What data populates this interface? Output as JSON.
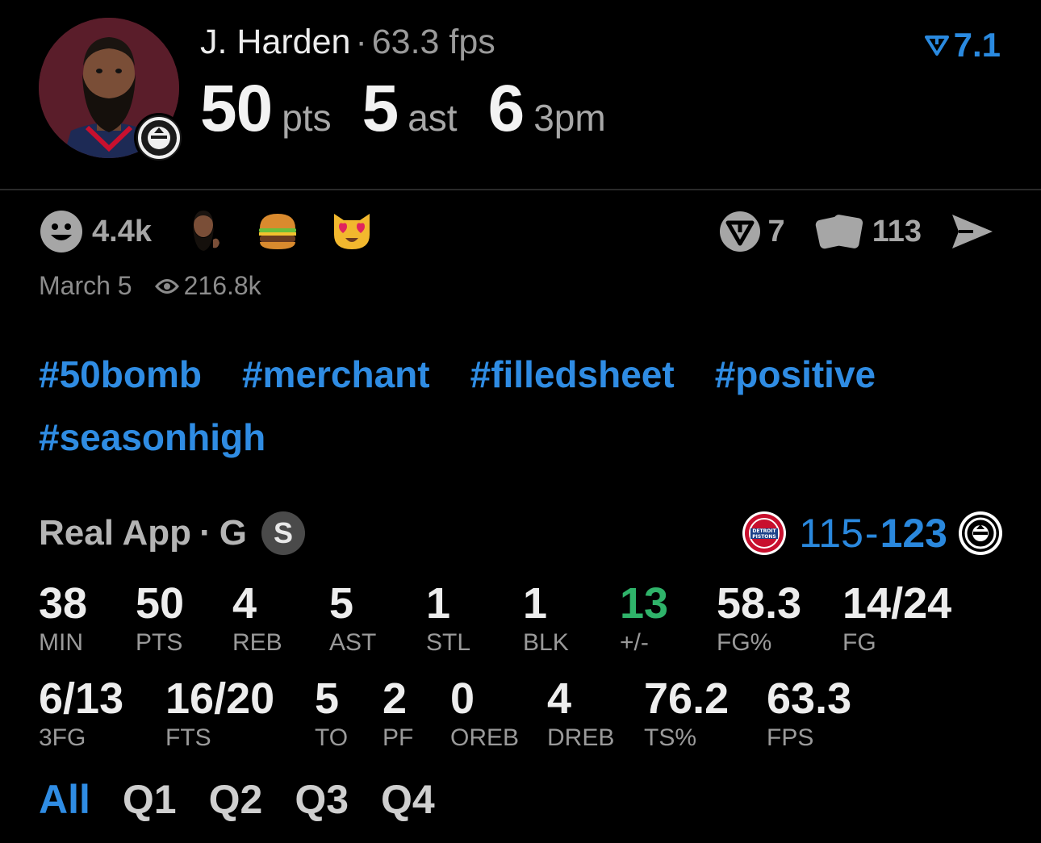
{
  "player": {
    "name": "J. Harden",
    "separator": "·",
    "fps_text": "63.3 fps",
    "avatar_icon": "player-avatar",
    "team_icon": "nets-logo-icon"
  },
  "headline_stats": [
    {
      "value": "50",
      "unit": "pts"
    },
    {
      "value": "5",
      "unit": "ast"
    },
    {
      "value": "6",
      "unit": "3pm"
    }
  ],
  "rating": {
    "icon": "real-v-icon",
    "value": "7.1",
    "color": "#2a8ae0"
  },
  "reactions": {
    "count": "4.4k",
    "emojis": [
      "harden-sticker",
      "hamburger-emoji",
      "heart-eyes-cat-emoji"
    ],
    "icon": "smiley-icon"
  },
  "actions": {
    "votes": {
      "icon": "v-badge-icon",
      "count": "7"
    },
    "cards": {
      "icon": "cards-icon",
      "count": "113"
    },
    "share": {
      "icon": "send-icon"
    }
  },
  "meta": {
    "date": "March 5",
    "views": "216.8k",
    "views_icon": "eye-icon"
  },
  "hashtags": [
    "#50bomb",
    "#merchant",
    "#filledsheet",
    "#positive",
    "#seasonhigh"
  ],
  "game": {
    "source": "Real App",
    "separator": "·",
    "position": "G",
    "badge": "S",
    "home_logo": "pistons-logo-icon",
    "away_logo": "nets-logo-icon",
    "home_score": "115",
    "dash": "-",
    "away_score": "123",
    "pistons_text": "DETROIT PISTONS"
  },
  "box_row1": [
    {
      "value": "38",
      "label": "MIN"
    },
    {
      "value": "50",
      "label": "PTS"
    },
    {
      "value": "4",
      "label": "REB"
    },
    {
      "value": "5",
      "label": "AST"
    },
    {
      "value": "1",
      "label": "STL"
    },
    {
      "value": "1",
      "label": "BLK"
    },
    {
      "value": "13",
      "label": "+/-"
    },
    {
      "value": "58.3",
      "label": "FG%"
    },
    {
      "value": "14/24",
      "label": "FG"
    }
  ],
  "box_row2": [
    {
      "value": "6/13",
      "label": "3FG"
    },
    {
      "value": "16/20",
      "label": "FTS"
    },
    {
      "value": "5",
      "label": "TO"
    },
    {
      "value": "2",
      "label": "PF"
    },
    {
      "value": "0",
      "label": "OREB"
    },
    {
      "value": "4",
      "label": "DREB"
    },
    {
      "value": "76.2",
      "label": "TS%"
    },
    {
      "value": "63.3",
      "label": "FPS"
    }
  ],
  "tabs": [
    "All",
    "Q1",
    "Q2",
    "Q3",
    "Q4"
  ],
  "active_tab": "All",
  "colors": {
    "accent": "#2f8ce3",
    "positive": "#2fb36a",
    "background": "#000000"
  }
}
